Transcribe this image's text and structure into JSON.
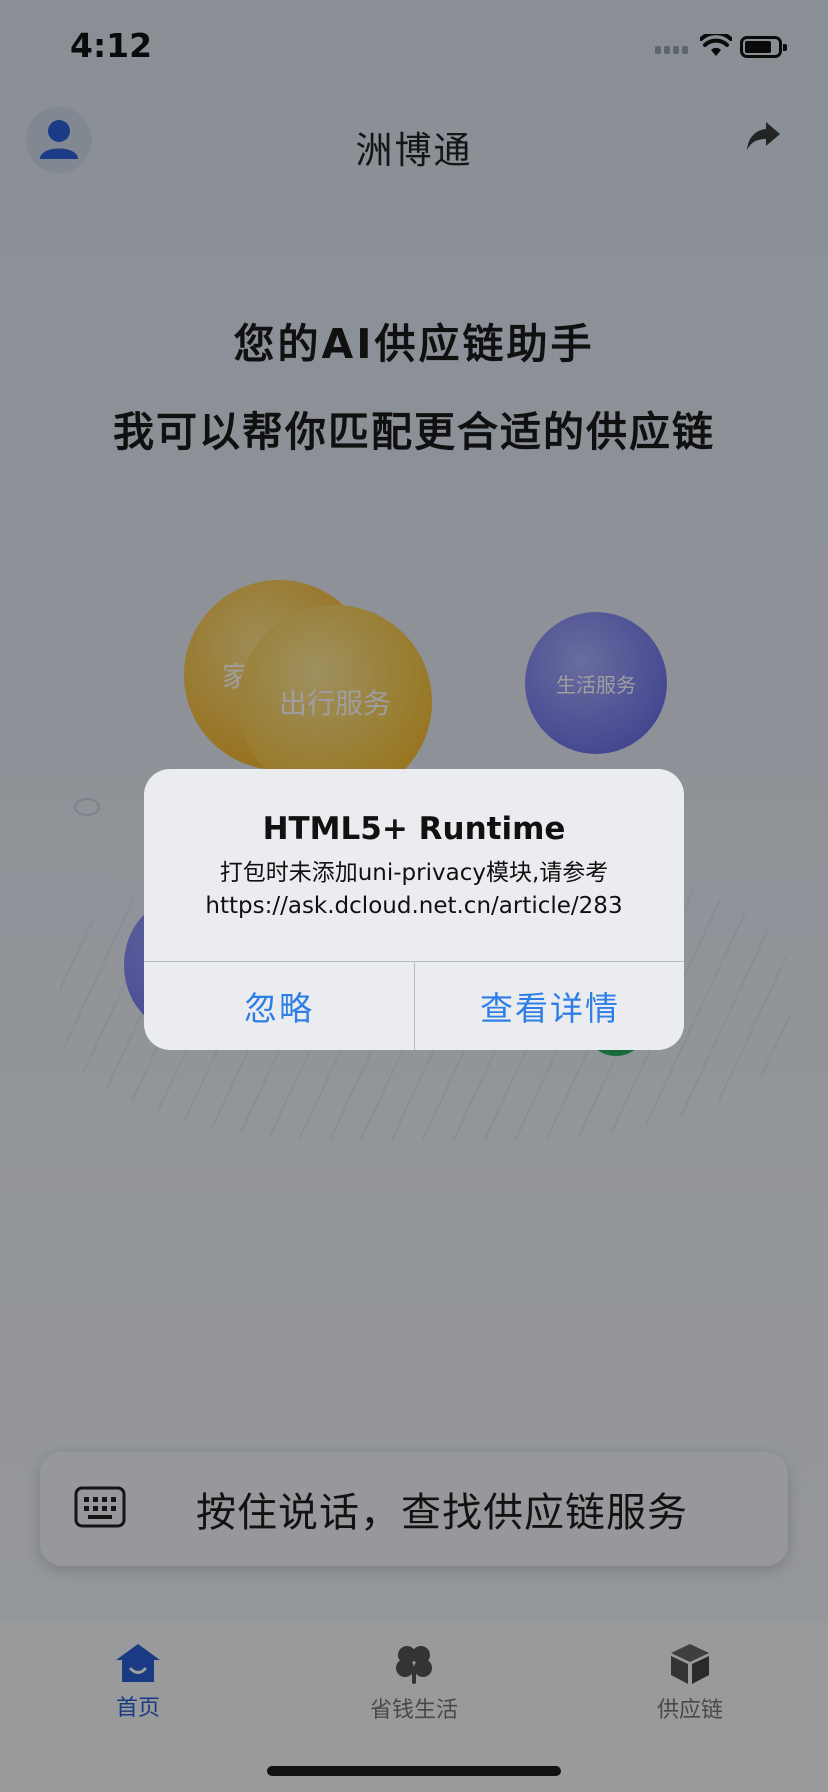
{
  "status_bar": {
    "time": "4:12"
  },
  "header": {
    "title": "洲博通"
  },
  "hero": {
    "line1": "您的AI供应链助手",
    "line2": "我可以帮你匹配更合适的供应链"
  },
  "bubbles": {
    "home_partial": "家",
    "travel": "出行服务",
    "life": "生活服务"
  },
  "voice": {
    "label": "按住说话，查找供应链服务"
  },
  "tabs": [
    {
      "label": "首页",
      "icon": "home-icon",
      "active": true
    },
    {
      "label": "省钱生活",
      "icon": "clover-icon",
      "active": false
    },
    {
      "label": "供应链",
      "icon": "box-icon",
      "active": false
    }
  ],
  "alert": {
    "title": "HTML5+ Runtime",
    "message_line1": "打包时未添加uni-privacy模块,请参考",
    "message_line2": "https://ask.dcloud.net.cn/article/283",
    "ignore_label": "忽略",
    "details_label": "查看详情"
  },
  "colors": {
    "accent": "#2a5fd6",
    "alert_button": "#2f7ee6",
    "bubble_yellow": "#f5b935",
    "bubble_purple": "#6f74ea"
  }
}
